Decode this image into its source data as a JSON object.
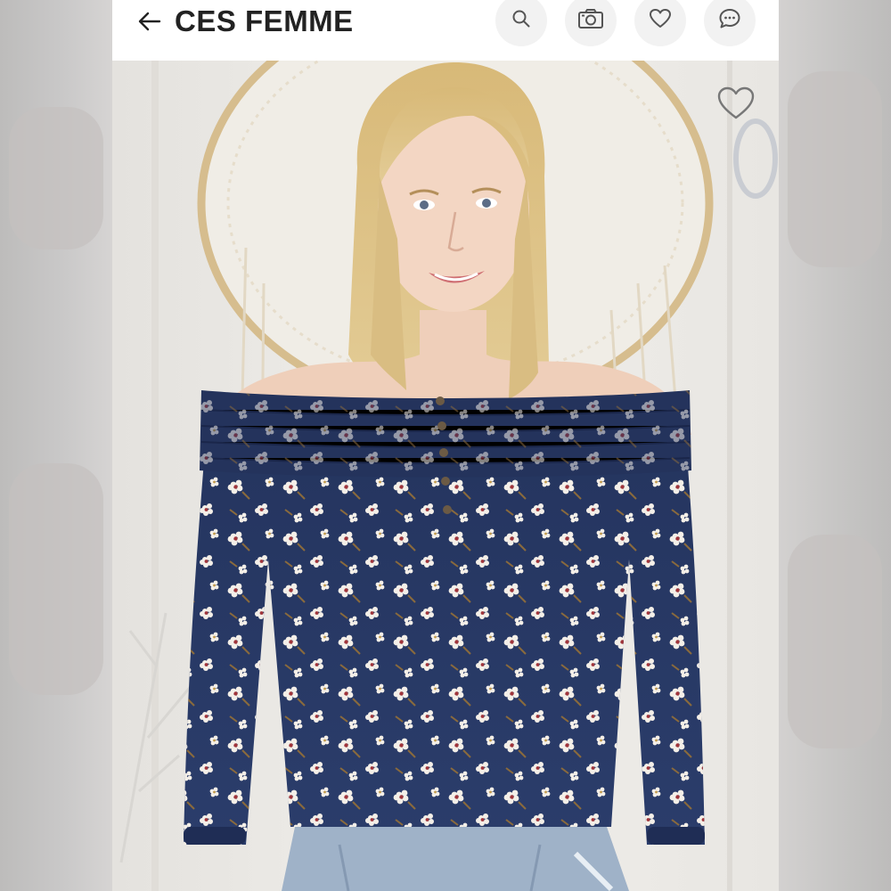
{
  "app": {
    "title": "CES FEMME"
  },
  "header": {
    "back_icon": "arrow-left-icon",
    "actions": [
      {
        "name": "search",
        "icon": "search-icon"
      },
      {
        "name": "camera",
        "icon": "camera-icon"
      },
      {
        "name": "like",
        "icon": "heart-icon"
      },
      {
        "name": "comments",
        "icon": "chat-icon"
      }
    ]
  },
  "product_image": {
    "subject": "navy-floral-off-shoulder-top",
    "favorite_icon": "heart-outline-icon"
  },
  "colors": {
    "header_bg": "#ffffff",
    "top_navy": "#26355f",
    "flower_white": "#f4efe8",
    "flower_red": "#a0343a"
  }
}
